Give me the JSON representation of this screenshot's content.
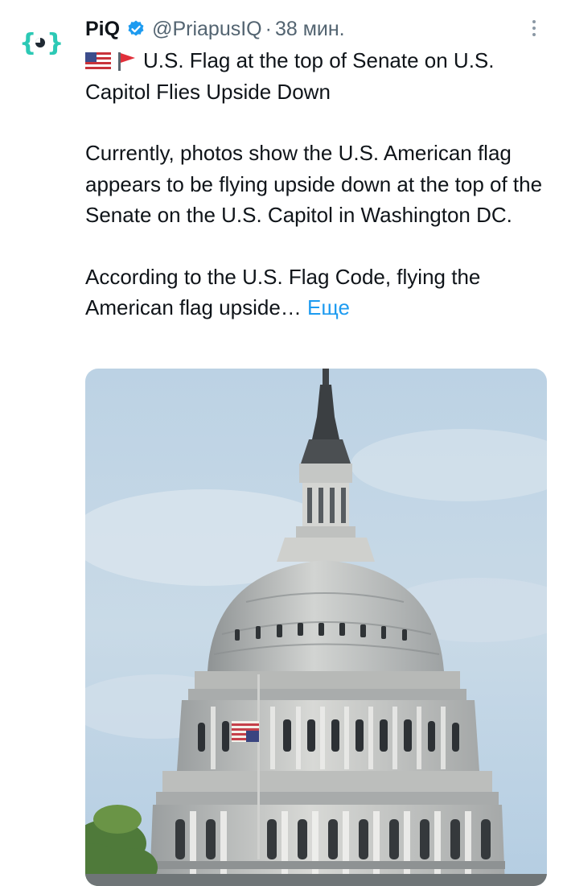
{
  "post": {
    "author_name": "PiQ",
    "handle": "@PriapusIQ",
    "separator": "·",
    "time": "38 мин.",
    "title": "U.S. Flag at the top of Senate on U.S. Capitol Flies Upside Down",
    "paragraph1": "Currently, photos show the U.S. American flag appears to be flying upside down at the top of the Senate on the U.S. Capitol in Washington DC.",
    "paragraph2": "According to the U.S. Flag Code, flying the American flag upside…",
    "more_label": "Еще"
  },
  "colors": {
    "accent": "#1d9bf0",
    "avatar_teal": "#2cc9b5",
    "text_secondary": "#536471"
  },
  "icons": {
    "avatar": "piq-logo-icon",
    "verified": "verified-badge-icon",
    "flag1": "us-flag-emoji",
    "flag2": "red-flag-emoji",
    "menu": "more-options-icon"
  }
}
